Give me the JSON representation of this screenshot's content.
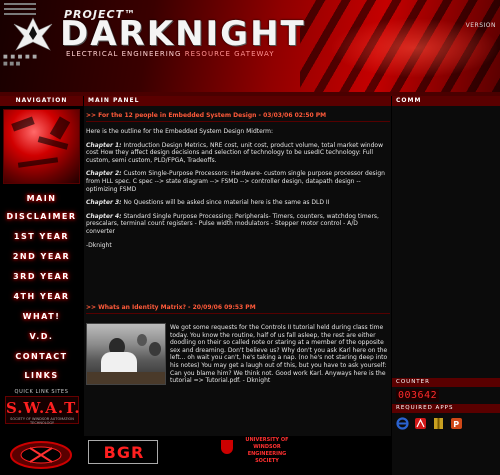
{
  "header": {
    "brand_project": "PROJECT™",
    "brand_name": "DARKNIGHT",
    "tagline_main": "ELECTRICAL ENGINEERING",
    "tagline_dim": "RESOURCE GATEWAY",
    "version_label": "VERSION"
  },
  "columns": {
    "navigation": "NAVIGATION",
    "main_panel": "MAIN PANEL",
    "comm": "COMM"
  },
  "nav": {
    "items": [
      {
        "label": "MAIN"
      },
      {
        "label": "DISCLAIMER"
      },
      {
        "label": "1ST YEAR"
      },
      {
        "label": "2ND YEAR"
      },
      {
        "label": "3RD YEAR"
      },
      {
        "label": "4TH YEAR"
      },
      {
        "label": "WHAT!"
      },
      {
        "label": "V.D."
      },
      {
        "label": "CONTACT"
      },
      {
        "label": "LINKS"
      }
    ],
    "quick_links_title": "QUICK LINK SITES",
    "swat_title": "S.W.A.T.",
    "swat_subtitle": "SOCIETY OF WINDSOR AUTOMATION TECHNOLOGY"
  },
  "posts": [
    {
      "title": ">> For the 12 people in Embedded System Design - 03/03/06  02:50 PM",
      "intro": "Here is the outline for the Embedded System Design Midterm:",
      "chapters": [
        {
          "label": "Chapter 1:",
          "text": "Introduction Design Metrics, NRE cost, unit cost, product volume, total market window cost How they affect design decisions and selection of technology to be usedIC technology: Full custom, semi custom, PLD/FPGA, Tradeoffs."
        },
        {
          "label": "Chapter 2:",
          "text": "Custom Single-Purpose Processors: Hardware- custom single purpose processor design from HLL spec. C spec --> state diagram --> FSMD --> controller design, datapath design -- optimizing FSMD"
        },
        {
          "label": "Chapter 3:",
          "text": "No Questions will be asked since material here is the same as DLD II"
        },
        {
          "label": "Chapter 4:",
          "text": "Standard Single Purpose Processing: Peripherals- Timers, counters, watchdog timers, prescalars, terminal count registers - Pulse width modulators - Stepper motor control - A/D converter"
        }
      ],
      "signature": "-Dknight"
    },
    {
      "title": ">> Whats an Identity Matrix? - 20/09/06  09:53 PM",
      "body": "We got some requests for the Controls II tutorial held during class time today. You know the routine, half of us fall asleep, the rest are either doodling on their so called note or staring at a member of the opposite sex and dreaming. Don't believe us? Why don't you ask Karl here on the left... oh wait you can't, he's taking a nap. (no he's not staring deep into his notes) You may get a laugh out of this, but you have to ask yourself: Can you blame him? We think not. Good work Karl. Anyways here is the tutorial =>",
      "link_text": "Tutorial.pdf",
      "signature": ". - Dknight"
    }
  ],
  "comm": {
    "counter_title": "COUNTER",
    "counter_value": "003642",
    "required_apps_title": "REQUIRED APPS",
    "apps": [
      {
        "icon": "internet-explorer-icon",
        "color": "#2a62d0"
      },
      {
        "icon": "acrobat-reader-icon",
        "color": "#d01818"
      },
      {
        "icon": "winzip-icon",
        "color": "#c8a020"
      },
      {
        "icon": "powerpoint-icon",
        "color": "#d04818"
      }
    ]
  },
  "footer": {
    "bgr_label": "BGR",
    "uwes_text": "UNIVERSITY OF WINDSOR ENGINEERING SOCIETY"
  },
  "colors": {
    "accent_red": "#ff2020",
    "bar_red": "#5a0000",
    "post_title": "#ff5a3a"
  }
}
